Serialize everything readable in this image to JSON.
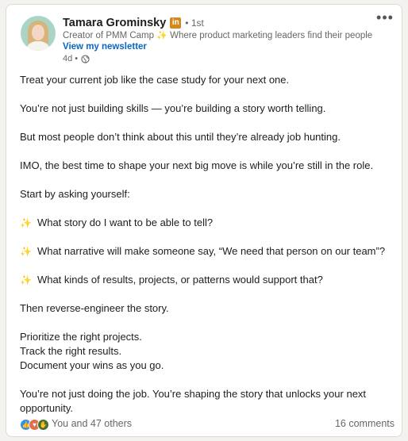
{
  "post": {
    "author_name": "Tamara Grominsky",
    "badge_icon": "linkedin-premium-icon",
    "badge_text": "in",
    "degree": "• 1st",
    "headline_prefix": "Creator of PMM Camp",
    "headline_sparkle": "✨",
    "headline_suffix": "Where product marketing leaders find their people",
    "newsletter_link": "View my newsletter",
    "time_ago": "4d •",
    "visibility_icon": "globe-icon",
    "more_label": "•••"
  },
  "body": {
    "p1": "Treat your current job like the case study for your next one.",
    "p2": "You’re not just building skills — you’re building a story worth telling.",
    "p3": "But most people don’t think about this until they’re already job hunting.",
    "p4": "IMO, the best time to shape your next big move is while you’re still in the role.",
    "p5": "Start by asking yourself:",
    "sparkle": "✨",
    "q1": "What story do I want to be able to tell?",
    "q2": "What narrative will make someone say, “We need that person on our team”?",
    "q3": "What kinds of results, projects, or patterns would support that?",
    "p6": "Then reverse-engineer the story.",
    "p7": "Prioritize the right projects.",
    "p8": "Track the right results.",
    "p9": "Document your wins as you go.",
    "p10": "You’re not just doing the job. You’re shaping the story that unlocks your next opportunity."
  },
  "footer": {
    "reaction_icons": [
      "like-icon",
      "love-icon",
      "celebrate-icon"
    ],
    "reactions_text": "You and 47 others",
    "comments_text": "16 comments"
  },
  "colors": {
    "link": "#0a66c2",
    "badge": "#d2891f",
    "text": "#1d1d1d",
    "muted": "#666666"
  }
}
